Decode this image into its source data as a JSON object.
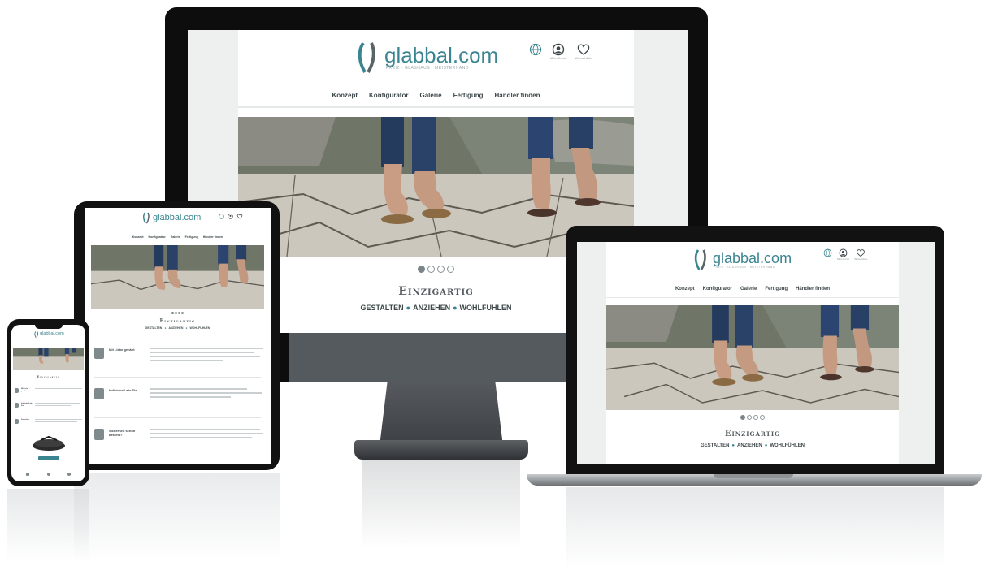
{
  "brand": {
    "name": "glabbal.com",
    "tagline": "FREIZ · GLASHAUS · MEISTERHAND"
  },
  "colors": {
    "brand_teal": "#3a8590",
    "gutter": "#eef0f0",
    "bezel": "#0d0d0e"
  },
  "header": {
    "language_icon": "globe-icon",
    "account_icon": "user-icon",
    "account_label": "Mein Konto",
    "wishlist_icon": "heart-icon",
    "wishlist_label": "Wunschliste"
  },
  "nav": {
    "items": [
      {
        "label": "Konzept"
      },
      {
        "label": "Konfigurator"
      },
      {
        "label": "Galerie"
      },
      {
        "label": "Fertigung"
      },
      {
        "label": "Händler finden"
      }
    ]
  },
  "hero": {
    "slides_total": 4,
    "active_slide": 1,
    "headline": "Einzigartig",
    "sub_items": [
      "GESTALTEN",
      "ANZIEHEN",
      "WOHLFÜHLEN"
    ],
    "separator": "●"
  },
  "tablet_sections": [
    {
      "label": "Mit Liebe genäht"
    },
    {
      "label": "Individuell wie Sie"
    },
    {
      "label": "Sicherheit schon bestellt?"
    }
  ],
  "phone_sections": [
    {
      "label": "Mit Liebe genäht"
    },
    {
      "label": "Individuell wie Sie"
    },
    {
      "label": "Sicherheit"
    }
  ]
}
